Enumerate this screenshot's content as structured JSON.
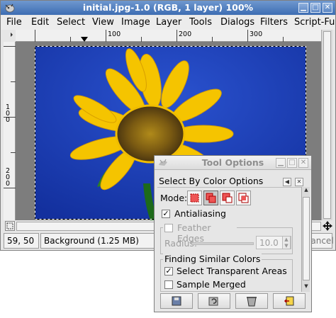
{
  "main_window": {
    "title": "initial.jpg-1.0 (RGB, 1 layer) 100%",
    "controls": [
      "minimize",
      "maximize",
      "close"
    ]
  },
  "menubar": [
    "File",
    "Edit",
    "Select",
    "View",
    "Image",
    "Layer",
    "Tools",
    "Dialogs",
    "Filters",
    "Script-Fu"
  ],
  "rulers": {
    "horizontal_labels": [
      "100",
      "200",
      "300"
    ],
    "vertical_labels": [
      "100",
      "200"
    ]
  },
  "status": {
    "coords": "59, 50",
    "layer_info": "Background (1.25 MB)",
    "cancel": "Cancel"
  },
  "tool_options": {
    "window_title": "Tool Options",
    "tool_name": "Select By Color Options",
    "mode_label": "Mode:",
    "mode_selected_index": 1,
    "antialiasing": {
      "label": "Antialiasing",
      "checked": true
    },
    "feather_edges": {
      "label": "Feather Edges",
      "checked": false,
      "enabled": false
    },
    "radius": {
      "label": "Radius:",
      "value": "10.0",
      "enabled": false
    },
    "similar_colors_group": "Finding Similar Colors",
    "select_transparent": {
      "label": "Select Transparent Areas",
      "checked": true
    },
    "sample_merged": {
      "label": "Sample Merged",
      "checked": false
    },
    "bottom_buttons": [
      "save-icon",
      "restore-icon",
      "delete-icon",
      "reset-icon"
    ]
  },
  "colors": {
    "title_blue": "#4b7cc0",
    "sky_blue": "#1b3db8",
    "petal_yellow": "#f5c400"
  }
}
